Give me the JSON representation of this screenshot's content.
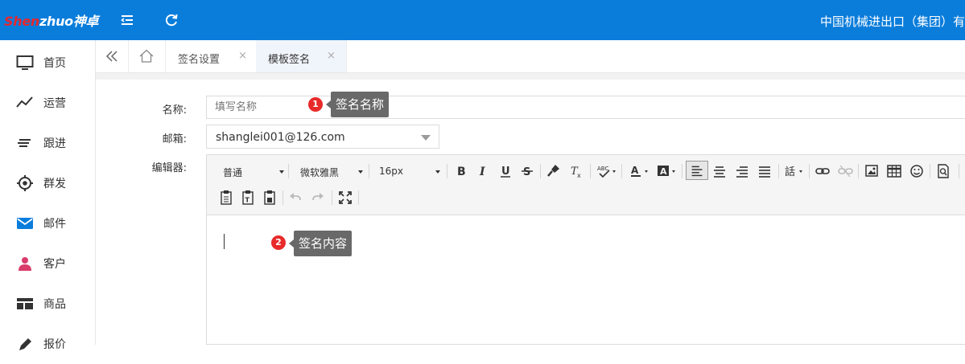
{
  "app": {
    "logo_main": "Shen",
    "logo_rest": "zhuo",
    "logo_cn": "神卓",
    "company": "中国机械进出口（集团）有"
  },
  "sidebar": {
    "items": [
      {
        "label": "首页",
        "icon": "monitor-icon"
      },
      {
        "label": "运营",
        "icon": "trend-line-icon"
      },
      {
        "label": "跟进",
        "icon": "list-lines-icon"
      },
      {
        "label": "群发",
        "icon": "target-icon"
      },
      {
        "label": "邮件",
        "icon": "mail-icon"
      },
      {
        "label": "客户",
        "icon": "user-icon"
      },
      {
        "label": "商品",
        "icon": "table-icon"
      },
      {
        "label": "报价",
        "icon": "pencil-icon"
      }
    ]
  },
  "tabs": [
    {
      "label": "签名设置",
      "close": "×"
    },
    {
      "label": "模板签名",
      "close": "×"
    }
  ],
  "form": {
    "name_label": "名称:",
    "name_placeholder": "填写名称",
    "email_label": "邮箱:",
    "email_value": "shanglei001@126.com",
    "editor_label": "编辑器:"
  },
  "toolbar": {
    "paragraph": "普通",
    "font": "微软雅黑",
    "size": "16px"
  },
  "callouts": [
    {
      "num": "1",
      "text": "签名名称"
    },
    {
      "num": "2",
      "text": "签名内容"
    }
  ],
  "colors": {
    "topbar": "#0a7ddb",
    "badge": "#e82a2a",
    "callout": "#696969",
    "accent": "#0a7ddb"
  }
}
